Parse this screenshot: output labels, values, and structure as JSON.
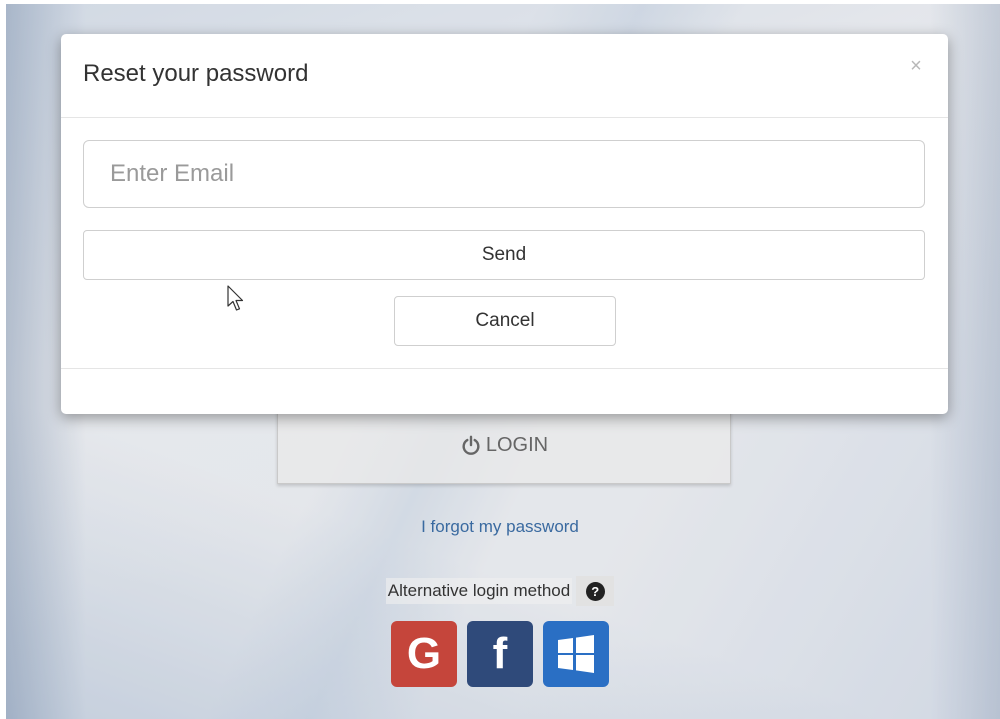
{
  "modal": {
    "title": "Reset your password",
    "close_label": "×",
    "email_placeholder": "Enter Email",
    "email_value": "",
    "send_label": "Send",
    "cancel_label": "Cancel"
  },
  "login_page": {
    "login_label": "LOGIN",
    "forgot_link": "I forgot my password",
    "alt_login_label": "Alternative login method",
    "help_icon_glyph": "?",
    "social": [
      {
        "name": "google",
        "glyph": "G",
        "color": "#c5453b"
      },
      {
        "name": "facebook",
        "glyph": "f",
        "color": "#2f4a7a"
      },
      {
        "name": "windows",
        "glyph": "",
        "color": "#2a6fc4"
      }
    ]
  },
  "icons": {
    "close": "close-icon",
    "power": "power-icon",
    "help": "question-circle-icon",
    "cursor": "mouse-pointer-icon"
  }
}
